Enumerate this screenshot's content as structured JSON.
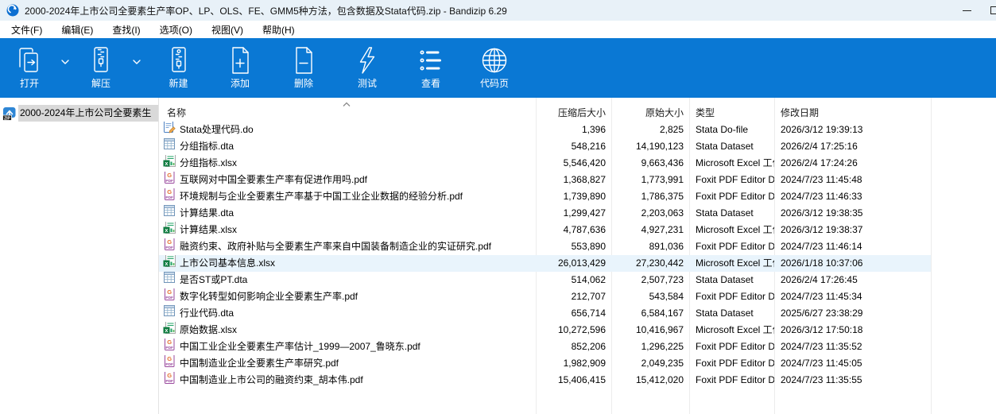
{
  "window": {
    "title": "2000-2024年上市公司全要素生产率OP、LP、OLS、FE、GMM5种方法，包含数据及Stata代码.zip - Bandizip 6.29",
    "app_name": "Bandizip",
    "version": "6.29"
  },
  "menu": {
    "items": [
      {
        "label": "文件(F)"
      },
      {
        "label": "编辑(E)"
      },
      {
        "label": "查找(I)"
      },
      {
        "label": "选项(O)"
      },
      {
        "label": "视图(V)"
      },
      {
        "label": "帮助(H)"
      }
    ]
  },
  "toolbar": {
    "buttons": [
      {
        "id": "open",
        "label": "打开",
        "dropdown": true
      },
      {
        "id": "extract",
        "label": "解压",
        "dropdown": true
      },
      {
        "id": "new",
        "label": "新建",
        "dropdown": false
      },
      {
        "id": "add",
        "label": "添加",
        "dropdown": false
      },
      {
        "id": "delete",
        "label": "删除",
        "dropdown": false
      },
      {
        "id": "test",
        "label": "测试",
        "dropdown": false
      },
      {
        "id": "view",
        "label": "查看",
        "dropdown": false
      },
      {
        "id": "codepage",
        "label": "代码页",
        "dropdown": false
      }
    ]
  },
  "sidebar": {
    "items": [
      {
        "label": "2000-2024年上市公司全要素生",
        "icon": "zip-archive",
        "selected": true
      }
    ]
  },
  "filelist": {
    "columns": [
      {
        "id": "name",
        "label": "名称"
      },
      {
        "id": "compressed",
        "label": "压缩后大小"
      },
      {
        "id": "original",
        "label": "原始大小"
      },
      {
        "id": "type",
        "label": "类型"
      },
      {
        "id": "modified",
        "label": "修改日期"
      }
    ],
    "files": [
      {
        "name": "Stata处理代码.do",
        "icon": "do",
        "compressed": "1,396",
        "original": "2,825",
        "type": "Stata Do-file",
        "modified": "2026/3/12 19:39:13",
        "selected": false
      },
      {
        "name": "分组指标.dta",
        "icon": "dta",
        "compressed": "548,216",
        "original": "14,190,123",
        "type": "Stata Dataset",
        "modified": "2026/2/4 17:25:16",
        "selected": false
      },
      {
        "name": "分组指标.xlsx",
        "icon": "xlsx",
        "compressed": "5,546,420",
        "original": "9,663,436",
        "type": "Microsoft Excel 工作表",
        "modified": "2026/2/4 17:24:26",
        "selected": false
      },
      {
        "name": "互联网对中国全要素生产率有促进作用吗.pdf",
        "icon": "pdf",
        "compressed": "1,368,827",
        "original": "1,773,991",
        "type": "Foxit PDF Editor Docu...",
        "modified": "2024/7/23 11:45:48",
        "selected": false
      },
      {
        "name": "环境规制与企业全要素生产率基于中国工业企业数据的经验分析.pdf",
        "icon": "pdf",
        "compressed": "1,739,890",
        "original": "1,786,375",
        "type": "Foxit PDF Editor Docu...",
        "modified": "2024/7/23 11:46:33",
        "selected": false
      },
      {
        "name": "计算结果.dta",
        "icon": "dta",
        "compressed": "1,299,427",
        "original": "2,203,063",
        "type": "Stata Dataset",
        "modified": "2026/3/12 19:38:35",
        "selected": false
      },
      {
        "name": "计算结果.xlsx",
        "icon": "xlsx",
        "compressed": "4,787,636",
        "original": "4,927,231",
        "type": "Microsoft Excel 工作表",
        "modified": "2026/3/12 19:38:37",
        "selected": false
      },
      {
        "name": "融资约束、政府补贴与全要素生产率来自中国装备制造企业的实证研究.pdf",
        "icon": "pdf",
        "compressed": "553,890",
        "original": "891,036",
        "type": "Foxit PDF Editor Docu...",
        "modified": "2024/7/23 11:46:14",
        "selected": false
      },
      {
        "name": "上市公司基本信息.xlsx",
        "icon": "xlsx",
        "compressed": "26,013,429",
        "original": "27,230,442",
        "type": "Microsoft Excel 工作表",
        "modified": "2026/1/18 10:37:06",
        "selected": true
      },
      {
        "name": "是否ST或PT.dta",
        "icon": "dta",
        "compressed": "514,062",
        "original": "2,507,723",
        "type": "Stata Dataset",
        "modified": "2026/2/4 17:26:45",
        "selected": false
      },
      {
        "name": "数字化转型如何影响企业全要素生产率.pdf",
        "icon": "pdf",
        "compressed": "212,707",
        "original": "543,584",
        "type": "Foxit PDF Editor Docu...",
        "modified": "2024/7/23 11:45:34",
        "selected": false
      },
      {
        "name": "行业代码.dta",
        "icon": "dta",
        "compressed": "656,714",
        "original": "6,584,167",
        "type": "Stata Dataset",
        "modified": "2025/6/27 23:38:29",
        "selected": false
      },
      {
        "name": "原始数据.xlsx",
        "icon": "xlsx",
        "compressed": "10,272,596",
        "original": "10,416,967",
        "type": "Microsoft Excel 工作表",
        "modified": "2026/3/12 17:50:18",
        "selected": false
      },
      {
        "name": "中国工业企业全要素生产率估计_1999—2007_鲁晓东.pdf",
        "icon": "pdf",
        "compressed": "852,206",
        "original": "1,296,225",
        "type": "Foxit PDF Editor Docu...",
        "modified": "2024/7/23 11:35:52",
        "selected": false
      },
      {
        "name": "中国制造业企业全要素生产率研究.pdf",
        "icon": "pdf",
        "compressed": "1,982,909",
        "original": "2,049,235",
        "type": "Foxit PDF Editor Docu...",
        "modified": "2024/7/23 11:45:05",
        "selected": false
      },
      {
        "name": "中国制造业上市公司的融资约束_胡本伟.pdf",
        "icon": "pdf",
        "compressed": "15,406,415",
        "original": "15,412,020",
        "type": "Foxit PDF Editor Docu...",
        "modified": "2024/7/23 11:35:55",
        "selected": false
      }
    ]
  },
  "colors": {
    "toolbar_blue": "#0a78d4",
    "titlebar_bg": "#e8f1f8",
    "row_selection": "#e9f4fc",
    "tree_selection": "#d9d9d9",
    "excel_green": "#107c41",
    "pdf_purple": "#9a4a9e",
    "stata_blue": "#4a7fc1"
  }
}
